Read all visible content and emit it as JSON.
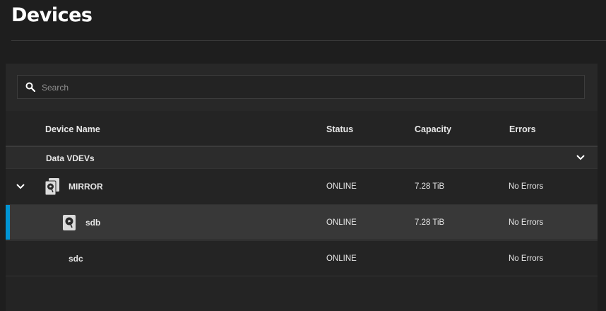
{
  "page": {
    "title": "Devices"
  },
  "search": {
    "placeholder": "Search",
    "value": ""
  },
  "table": {
    "columns": [
      "Device Name",
      "Status",
      "Capacity",
      "Errors"
    ],
    "group": {
      "label": "Data VDEVs"
    },
    "rows": [
      {
        "name": "MIRROR",
        "status": "ONLINE",
        "capacity": "7.28 TiB",
        "errors": "No Errors"
      },
      {
        "name": "sdb",
        "status": "ONLINE",
        "capacity": "7.28 TiB",
        "errors": "No Errors"
      },
      {
        "name": "sdc",
        "status": "ONLINE",
        "capacity": "",
        "errors": "No Errors"
      }
    ]
  },
  "colors": {
    "accent": "#0095d5",
    "background": "#1e1e1e",
    "selected_row": "#383838"
  },
  "icons": [
    "search-icon",
    "chevron-down-icon",
    "disk-group-icon",
    "hard-disk-icon"
  ]
}
